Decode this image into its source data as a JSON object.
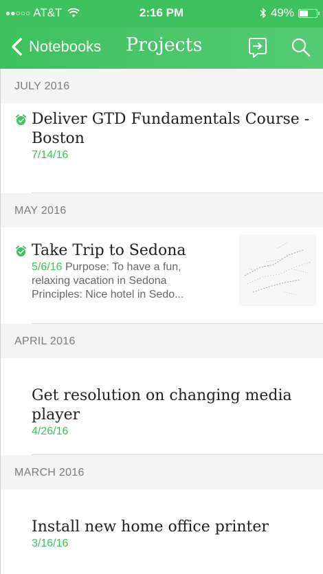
{
  "status_bar": {
    "signal_dots": "●●○○○",
    "carrier": "AT&T",
    "time": "2:16 PM",
    "battery_percent": "49%",
    "battery_level": 0.49
  },
  "nav": {
    "back_label": "Notebooks",
    "title": "Projects"
  },
  "sections": [
    {
      "header": "JULY 2016",
      "notes": [
        {
          "title": "Deliver GTD Fundamentals Course - Boston",
          "date": "7/14/16",
          "snippet": "",
          "reminder": true
        }
      ]
    },
    {
      "header": "MAY 2016",
      "notes": [
        {
          "title": "Take Trip to Sedona",
          "date": "5/6/16",
          "snippet_line1": "Purpose: To have a fun,",
          "snippet_line2": "relaxing vacation in Sedona",
          "snippet_line3": "Principles: Nice hotel in Sedo...",
          "reminder": true,
          "has_thumbnail": true
        }
      ]
    },
    {
      "header": "APRIL 2016",
      "notes": [
        {
          "title": "Get resolution on changing media player",
          "date": "4/26/16",
          "reminder": false
        }
      ]
    },
    {
      "header": "MARCH 2016",
      "notes": [
        {
          "title": "Install new home office printer",
          "date": "3/16/16",
          "reminder": false
        }
      ]
    }
  ],
  "colors": {
    "accent": "#3cc15c",
    "section_bg": "#f4f4f4",
    "section_text": "#7a7a7a"
  },
  "icons": {
    "back": "chevron-left-icon",
    "share": "share-note-icon",
    "search": "search-icon",
    "reminder": "alarm-clock-icon",
    "bluetooth": "bluetooth-icon",
    "wifi": "wifi-icon",
    "battery": "battery-icon"
  }
}
